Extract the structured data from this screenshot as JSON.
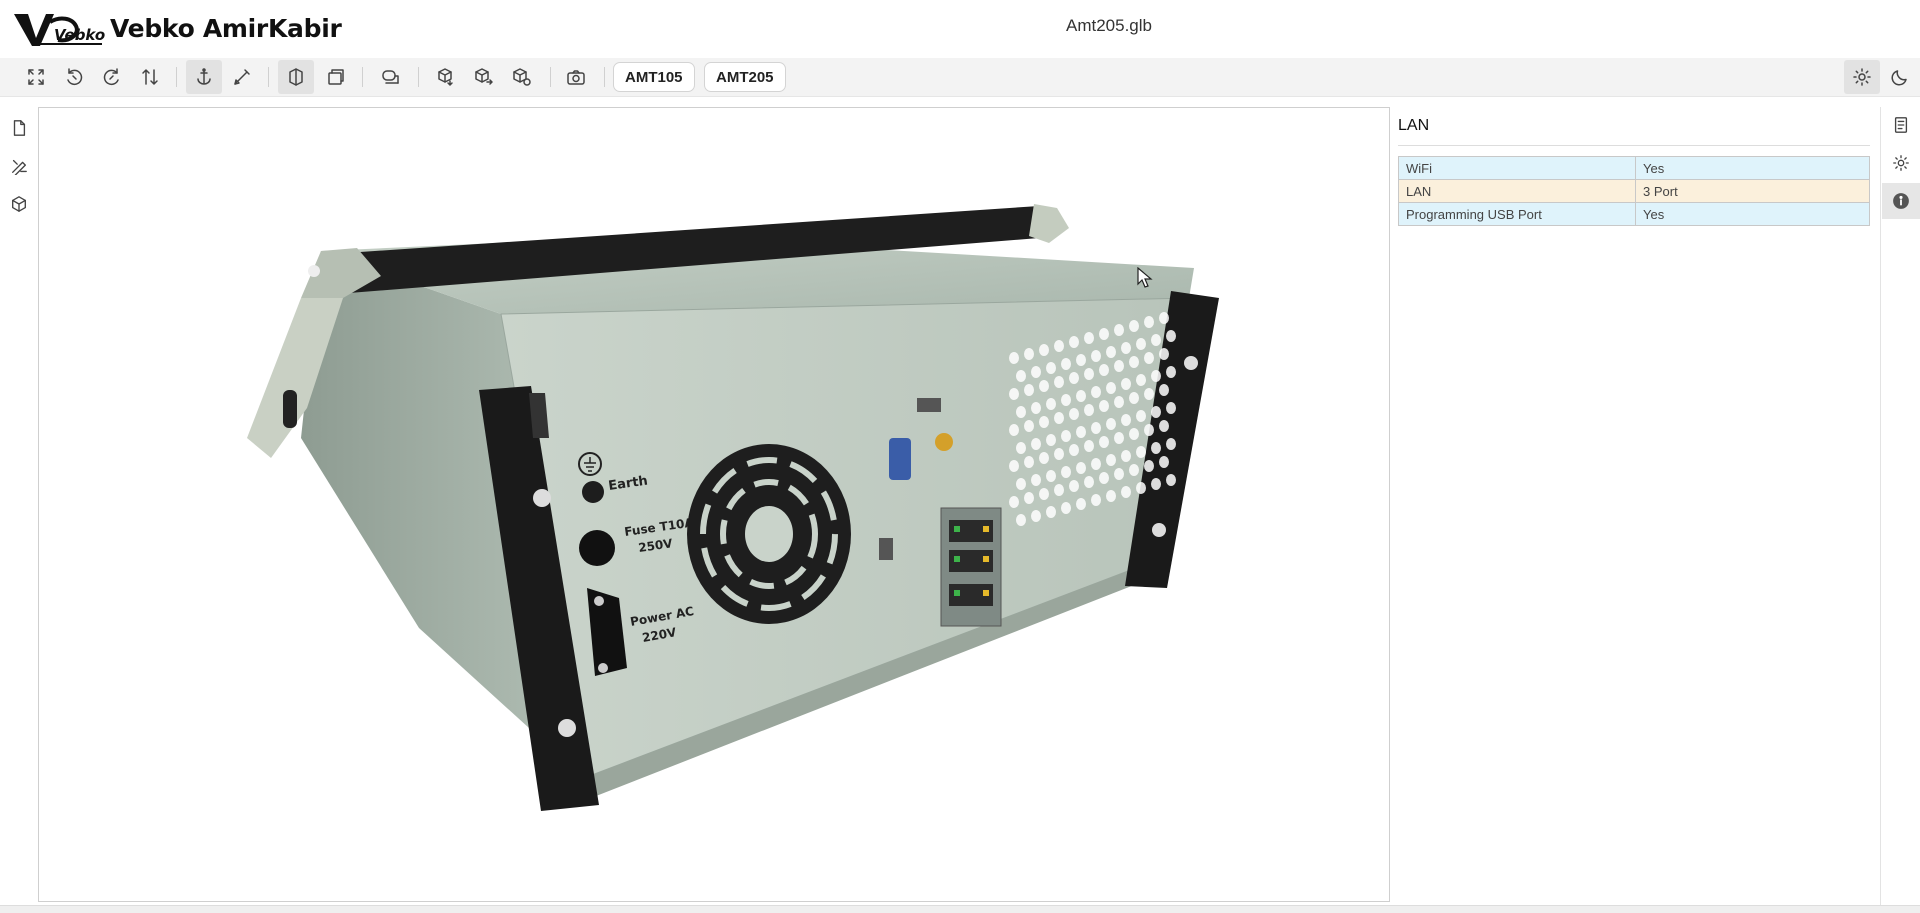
{
  "header": {
    "brand_name": "Vebko AmirKabir",
    "logo_text": "Vebko",
    "file_title": "Amt205.glb"
  },
  "toolbar": {
    "tools": [
      {
        "name": "fit-view-icon"
      },
      {
        "name": "rotate-left-icon"
      },
      {
        "name": "rotate-right-icon"
      },
      {
        "name": "flip-vertical-icon"
      },
      {
        "name": "anchor-icon"
      },
      {
        "name": "measure-icon"
      },
      {
        "name": "section-icon"
      },
      {
        "name": "pages-icon"
      },
      {
        "name": "explode-icon"
      },
      {
        "name": "cube-front-icon"
      },
      {
        "name": "cube-right-icon"
      },
      {
        "name": "cube-top-icon"
      },
      {
        "name": "camera-icon"
      }
    ],
    "model_buttons": [
      "AMT105",
      "AMT205"
    ],
    "theme": {
      "light": "sun-icon",
      "dark": "moon-icon"
    }
  },
  "left_rail": [
    "document-icon",
    "draw-icon",
    "cube-icon"
  ],
  "right_rail": [
    "list-icon",
    "settings-icon",
    "info-icon"
  ],
  "info_panel": {
    "title": "LAN",
    "rows": [
      {
        "key": "WiFi",
        "value": "Yes",
        "color": "#dff3fb"
      },
      {
        "key": "LAN",
        "value": "3 Port",
        "color": "#fbf0dc"
      },
      {
        "key": "Programming USB Port",
        "value": "Yes",
        "color": "#dff3fb"
      }
    ]
  },
  "model_labels": {
    "earth": "Earth",
    "fuse_1": "Fuse T10A",
    "fuse_2": "250V",
    "power_1": "Power AC",
    "power_2": "220V"
  },
  "colors": {
    "accent_blue": "#dff3fb",
    "accent_orange": "#fbf0dc",
    "device_body": "#b9c6bc",
    "device_handle": "#1f1f1f"
  }
}
